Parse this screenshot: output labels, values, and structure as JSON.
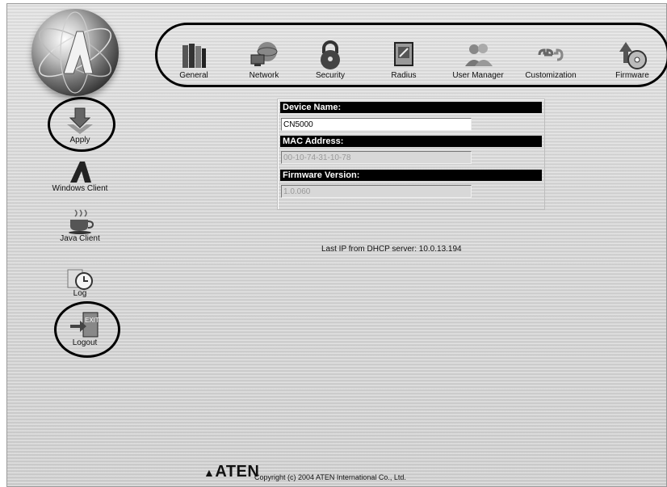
{
  "toolbar": {
    "items": [
      {
        "label": "General",
        "icon": "books-icon"
      },
      {
        "label": "Network",
        "icon": "network-globe-icon"
      },
      {
        "label": "Security",
        "icon": "padlock-icon"
      },
      {
        "label": "Radius",
        "icon": "radius-document-icon"
      },
      {
        "label": "User Manager",
        "icon": "users-icon"
      },
      {
        "label": "Customization",
        "icon": "wrench-icon"
      },
      {
        "label": "Firmware",
        "icon": "firmware-disc-icon"
      }
    ]
  },
  "sidebar": {
    "items": [
      {
        "label": "Apply",
        "icon": "apply-arrow-icon"
      },
      {
        "label": "Windows Client",
        "icon": "windows-client-icon"
      },
      {
        "label": "Java Client",
        "icon": "java-cup-icon"
      },
      {
        "label": "Log",
        "icon": "log-clock-icon"
      },
      {
        "label": "Logout",
        "icon": "exit-door-icon"
      }
    ]
  },
  "form": {
    "device_name_label": "Device Name:",
    "device_name_value": "CN5000",
    "mac_label": "MAC Address:",
    "mac_value": "00-10-74-31-10-78",
    "firmware_label": "Firmware Version:",
    "firmware_value": "1.0.060"
  },
  "status": {
    "dhcp_text": "Last IP from DHCP server: 10.0.13.194"
  },
  "footer": {
    "brand": "ATEN",
    "copyright": "Copyright (c) 2004 ATEN International Co., Ltd."
  }
}
